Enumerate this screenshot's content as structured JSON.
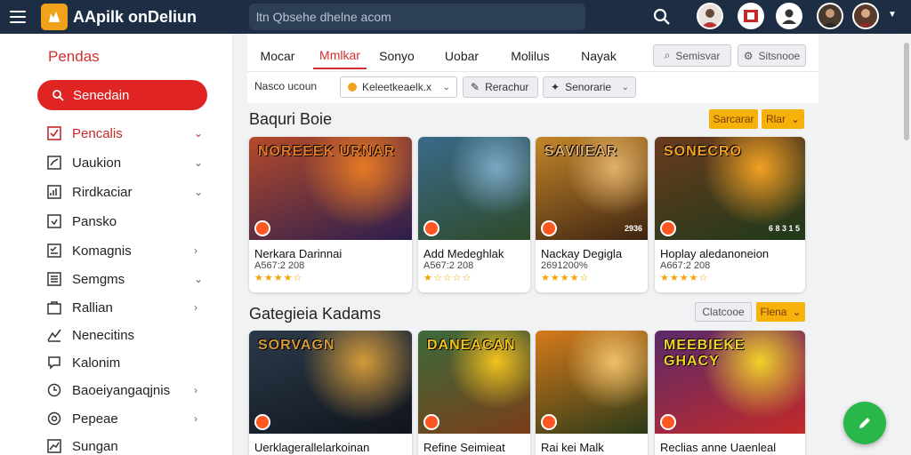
{
  "app": {
    "title": "AApilk onDeliun",
    "logo": "hand-logo-icon"
  },
  "search": {
    "placeholder": "ltn Qbsehe dhelne acom"
  },
  "sidebar": {
    "title": "Pendas",
    "search_button": "Senedain",
    "items": [
      {
        "label": "Pencalis",
        "icon": "checkbox-icon",
        "chevron": "down"
      },
      {
        "label": "Uaukion",
        "icon": "chart-icon",
        "chevron": "down"
      },
      {
        "label": "Rirdkaciar",
        "icon": "signal-icon",
        "chevron": "down"
      },
      {
        "label": "Pansko",
        "icon": "edit-icon",
        "chevron": ""
      },
      {
        "label": "Komagnis",
        "icon": "checklist-icon",
        "chevron": "right"
      },
      {
        "label": "Semgms",
        "icon": "list-icon",
        "chevron": "down"
      },
      {
        "label": "Rallian",
        "icon": "bag-icon",
        "chevron": "right"
      },
      {
        "label": "Nenecitins",
        "icon": "trend-icon",
        "chevron": ""
      },
      {
        "label": "Kalonim",
        "icon": "chat-icon",
        "chevron": ""
      },
      {
        "label": "Baoeiyangaqjnis",
        "icon": "clock-icon",
        "chevron": "right"
      },
      {
        "label": "Pepeae",
        "icon": "gear-icon",
        "chevron": "right"
      },
      {
        "label": "Sungan",
        "icon": "trend-icon",
        "chevron": ""
      }
    ]
  },
  "tabs": [
    "Mocar",
    "Mmlkar",
    "Sonyo",
    "Uobar",
    "Molilus",
    "Nayak"
  ],
  "toolbar": {
    "search_button": "Semisvar",
    "settings_button": "Sitsnooe",
    "filter_label": "Nasco ucoun",
    "filter_select": "Keleetkeaelk.x",
    "filter_button": "Rerachur",
    "sort_select": "Senorarie"
  },
  "section1": {
    "title": "Baquri Boie",
    "btn_primary": "Sarcarar",
    "btn_dropdown": "Rlar",
    "cards": [
      {
        "thumb_title": "Noreeek Urnar",
        "name": "Nerkara Darinnai",
        "sub": "A567:2 208",
        "stars": "★★★★☆",
        "count": "",
        "thumb_colors": [
          "#b44a2a",
          "#2c1e4e",
          "#e57a25"
        ]
      },
      {
        "thumb_title": "",
        "name": "Add Medeghlak",
        "sub": "A567:2 208",
        "stars": "★☆☆☆☆",
        "count": "",
        "thumb_colors": [
          "#3a6a8a",
          "#2f4a2a",
          "#7ba7c4"
        ]
      },
      {
        "thumb_title": "Saviiear",
        "name": "Nackay Degigla",
        "sub": "2691200%",
        "stars": "★★★★☆",
        "count": "2936",
        "thumb_colors": [
          "#c4862a",
          "#3e2412",
          "#e0b16a"
        ]
      },
      {
        "thumb_title": "Sonecro",
        "name": "Hoplay aledanoneion",
        "sub": "A667:2 208",
        "stars": "★★★★☆",
        "count": "6 8 3 1 5",
        "thumb_colors": [
          "#6a3a1e",
          "#1e3a1a",
          "#f2a124"
        ]
      }
    ]
  },
  "section2": {
    "title": "Gategieia Kadams",
    "btn_secondary": "Clatcooe",
    "btn_primary": "Flena",
    "cards": [
      {
        "thumb_title": "Sorvagn",
        "name": "Uerklagerallelarkoinan",
        "sub": "",
        "stars": "",
        "count": "",
        "thumb_colors": [
          "#2a3a4a",
          "#10141c",
          "#d49a3a"
        ]
      },
      {
        "thumb_title": "Daneacan",
        "name": "Refine Seimieat",
        "sub": "",
        "stars": "",
        "count": "",
        "thumb_colors": [
          "#3c6a3a",
          "#7a3e1a",
          "#f2c21e"
        ]
      },
      {
        "thumb_title": "",
        "name": "Rai kei Malk",
        "sub": "",
        "stars": "",
        "count": "",
        "thumb_colors": [
          "#d67a1a",
          "#2a3a1a",
          "#f0c06a"
        ]
      },
      {
        "thumb_title": "Meebieke Ghacy",
        "name": "Reclias anne Uaenleal",
        "sub": "",
        "stars": "",
        "count": "",
        "thumb_colors": [
          "#5a2a6a",
          "#c22a2a",
          "#f2d22a"
        ]
      }
    ]
  },
  "colors": {
    "topbar": "#1c2d44",
    "accent_red": "#e02424",
    "accent_orange": "#f6b10b",
    "fab_green": "#29b74a"
  }
}
